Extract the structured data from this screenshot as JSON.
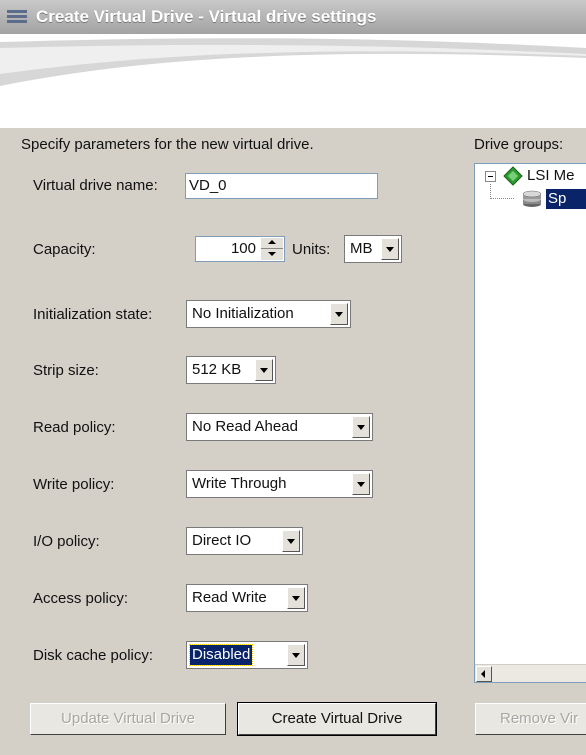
{
  "window": {
    "title": "Create Virtual Drive - Virtual drive settings"
  },
  "form": {
    "heading": "Specify parameters for the new virtual drive.",
    "name_label": "Virtual drive name:",
    "name_value": "VD_0",
    "capacity_label": "Capacity:",
    "capacity_value": "100",
    "units_label": "Units:",
    "units_value": "MB",
    "init_label": "Initialization state:",
    "init_value": "No Initialization",
    "strip_label": "Strip size:",
    "strip_value": "512 KB",
    "read_label": "Read policy:",
    "read_value": "No Read Ahead",
    "write_label": "Write policy:",
    "write_value": "Write Through",
    "io_label": "I/O policy:",
    "io_value": "Direct IO",
    "access_label": "Access policy:",
    "access_value": "Read Write",
    "disk_cache_label": "Disk cache policy:",
    "disk_cache_value": "Disabled"
  },
  "drive_groups": {
    "label": "Drive groups:",
    "tree": [
      {
        "label": "LSI Me",
        "icon": "controller-icon",
        "expanded": true
      },
      {
        "label": "Sp",
        "icon": "drive-group-icon",
        "selected": true
      }
    ]
  },
  "buttons": {
    "update": "Update Virtual Drive",
    "create": "Create Virtual Drive",
    "remove": "Remove Vir"
  }
}
